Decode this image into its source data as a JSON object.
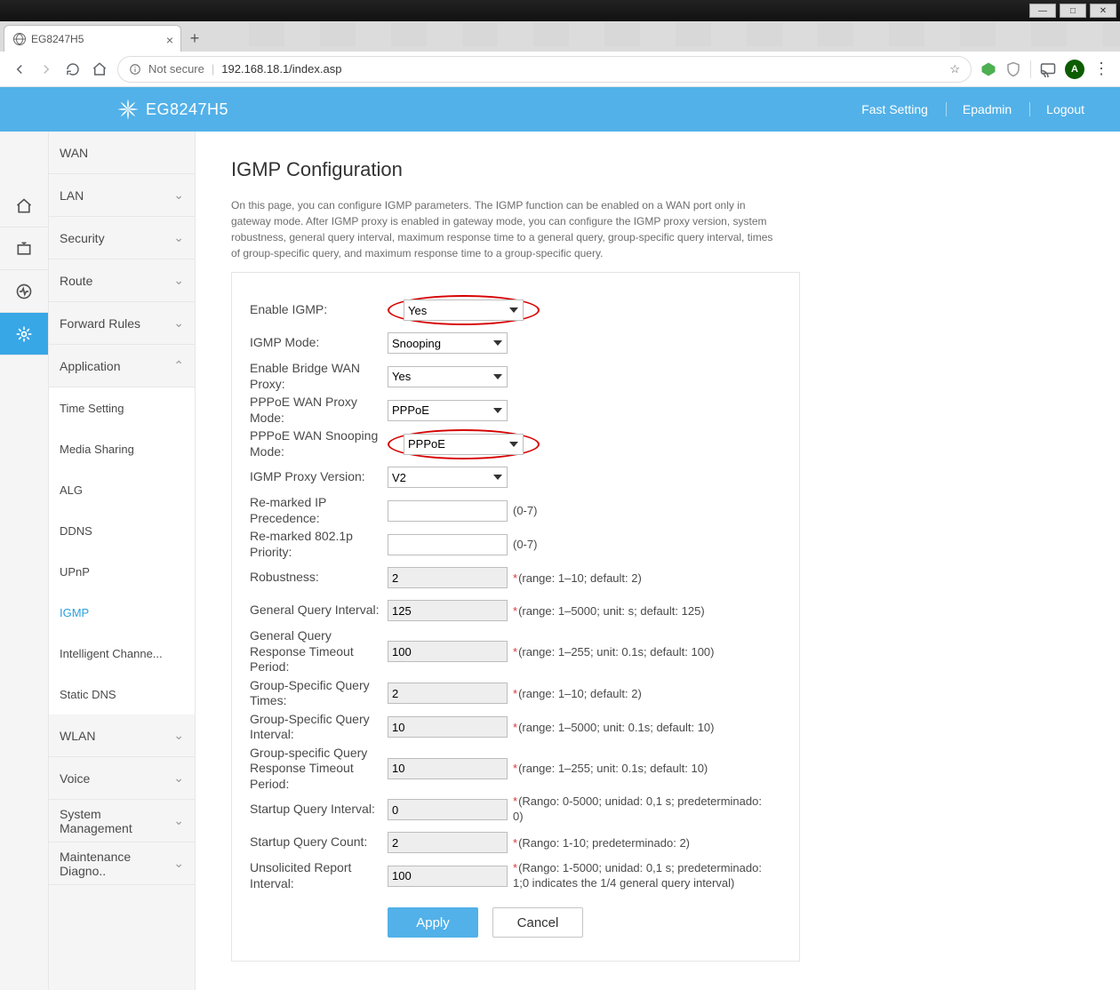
{
  "browser": {
    "tab_title": "EG8247H5",
    "not_secure": "Not secure",
    "url": "192.168.18.1/index.asp",
    "avatar_letter": "A"
  },
  "header": {
    "device": "EG8247H5",
    "links": {
      "fast": "Fast Setting",
      "user": "Epadmin",
      "logout": "Logout"
    }
  },
  "sidebar": {
    "groups": {
      "wan": "WAN",
      "lan": "LAN",
      "security": "Security",
      "route": "Route",
      "forward": "Forward Rules",
      "application": "Application",
      "wlan": "WLAN",
      "voice": "Voice",
      "sysman": "System Management",
      "diag": "Maintenance Diagno.."
    },
    "app_items": [
      "Time Setting",
      "Media Sharing",
      "ALG",
      "DDNS",
      "UPnP",
      "IGMP",
      "Intelligent Channe...",
      "Static DNS"
    ]
  },
  "page": {
    "title": "IGMP Configuration",
    "desc": "On this page, you can configure IGMP parameters. The IGMP function can be enabled on a WAN port only in gateway mode. After IGMP proxy is enabled in gateway mode, you can configure the IGMP proxy version, system robustness, general query interval, maximum response time to a general query, group-specific query interval, times of group-specific query, and maximum response time to a group-specific query."
  },
  "form": {
    "enable_igmp": {
      "label": "Enable IGMP:",
      "value": "Yes"
    },
    "igmp_mode": {
      "label": "IGMP Mode:",
      "value": "Snooping"
    },
    "bridge_wan": {
      "label": "Enable Bridge WAN Proxy:",
      "value": "Yes"
    },
    "pppoe_proxy": {
      "label": "PPPoE WAN Proxy Mode:",
      "value": "PPPoE"
    },
    "pppoe_snoop": {
      "label": "PPPoE WAN Snooping Mode:",
      "value": "PPPoE"
    },
    "proxy_ver": {
      "label": "IGMP Proxy Version:",
      "value": "V2"
    },
    "ip_prec": {
      "label": "Re-marked IP Precedence:",
      "value": "",
      "hint": "(0-7)"
    },
    "p8021": {
      "label": "Re-marked 802.1p Priority:",
      "value": "",
      "hint": "(0-7)"
    },
    "robust": {
      "label": "Robustness:",
      "value": "2",
      "hint": "(range: 1–10; default: 2)"
    },
    "gqi": {
      "label": "General Query Interval:",
      "value": "125",
      "hint": "(range: 1–5000; unit: s; default: 125)"
    },
    "gqr": {
      "label": "General Query Response Timeout Period:",
      "value": "100",
      "hint": "(range: 1–255; unit: 0.1s; default: 100)"
    },
    "gsqt": {
      "label": "Group-Specific Query Times:",
      "value": "2",
      "hint": "(range: 1–10; default: 2)"
    },
    "gsqi": {
      "label": "Group-Specific Query Interval:",
      "value": "10",
      "hint": "(range: 1–5000; unit: 0.1s; default: 10)"
    },
    "gsqr": {
      "label": "Group-specific Query Response Timeout Period:",
      "value": "10",
      "hint": "(range: 1–255; unit: 0.1s; default: 10)"
    },
    "sqi": {
      "label": "Startup Query Interval:",
      "value": "0",
      "hint": "(Rango: 0-5000; unidad: 0,1 s; predeterminado: 0)"
    },
    "sqc": {
      "label": "Startup Query Count:",
      "value": "2",
      "hint": "(Rango: 1-10; predeterminado: 2)"
    },
    "uri": {
      "label": "Unsolicited Report Interval:",
      "value": "100",
      "hint": "(Rango: 1-5000; unidad: 0,1 s; predeterminado: 1;0 indicates the 1/4 general query interval)"
    }
  },
  "buttons": {
    "apply": "Apply",
    "cancel": "Cancel"
  }
}
